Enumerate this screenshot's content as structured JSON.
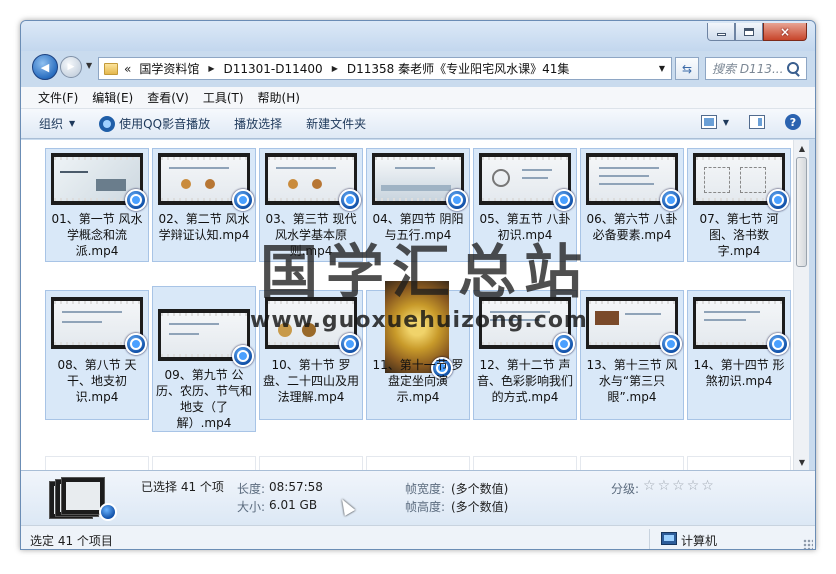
{
  "window": {
    "controls": {
      "minimize": "minimize",
      "maximize": "maximize",
      "close": "×"
    }
  },
  "nav": {
    "back_glyph": "◀",
    "forward_glyph": "▶",
    "breadcrumb": [
      "国学资料馆",
      "D11301-D11400",
      "D11358 秦老师《专业阳宅风水课》41集"
    ],
    "chevron": "«",
    "separator": "▶",
    "search_placeholder": "搜索 D113...",
    "refresh_glyph": "⇆"
  },
  "menu": [
    "文件(F)",
    "编辑(E)",
    "查看(V)",
    "工具(T)",
    "帮助(H)"
  ],
  "toolbar": {
    "organize": "组织",
    "qq_play": "使用QQ影音播放",
    "play_selection": "播放选择",
    "new_folder": "新建文件夹",
    "help": "?"
  },
  "files": [
    "01、第一节 风水学概念和流派.mp4",
    "02、第二节 风水学辩证认知.mp4",
    "03、第三节 现代风水学基本原则.mp4",
    "04、第四节 阴阳与五行.mp4",
    "05、第五节 八卦初识.mp4",
    "06、第六节 八卦必备要素.mp4",
    "07、第七节 河图、洛书数字.mp4",
    "08、第八节 天干、地支初识.mp4",
    "09、第九节 公历、农历、节气和地支（了解）.mp4",
    "10、第十节 罗盘、二十四山及用法理解.mp4",
    "11、第十一节 罗盘定坐向演示.mp4",
    "12、第十二节 声音、色彩影响我们的方式.mp4",
    "13、第十三节 风水与“第三只眼”.mp4",
    "14、第十四节 形煞初识.mp4"
  ],
  "watermark": {
    "title": "国学汇总站",
    "url": "www.guoxuehuizong.com"
  },
  "details": {
    "selected": "已选择 41 个项",
    "length_label": "长度:",
    "length_value": "08:57:58",
    "size_label": "大小:",
    "size_value": "6.01 GB",
    "frame_width_label": "帧宽度:",
    "frame_width_value": "(多个数值)",
    "frame_height_label": "帧高度:",
    "frame_height_value": "(多个数值)",
    "rating_label": "分级:",
    "rating_stars": 0
  },
  "status": {
    "text": "选定 41 个项目",
    "location": "计算机"
  },
  "colors": {
    "selection": "#d9e8f8",
    "selection_border": "#a8c4e6",
    "accent": "#1251a8"
  }
}
